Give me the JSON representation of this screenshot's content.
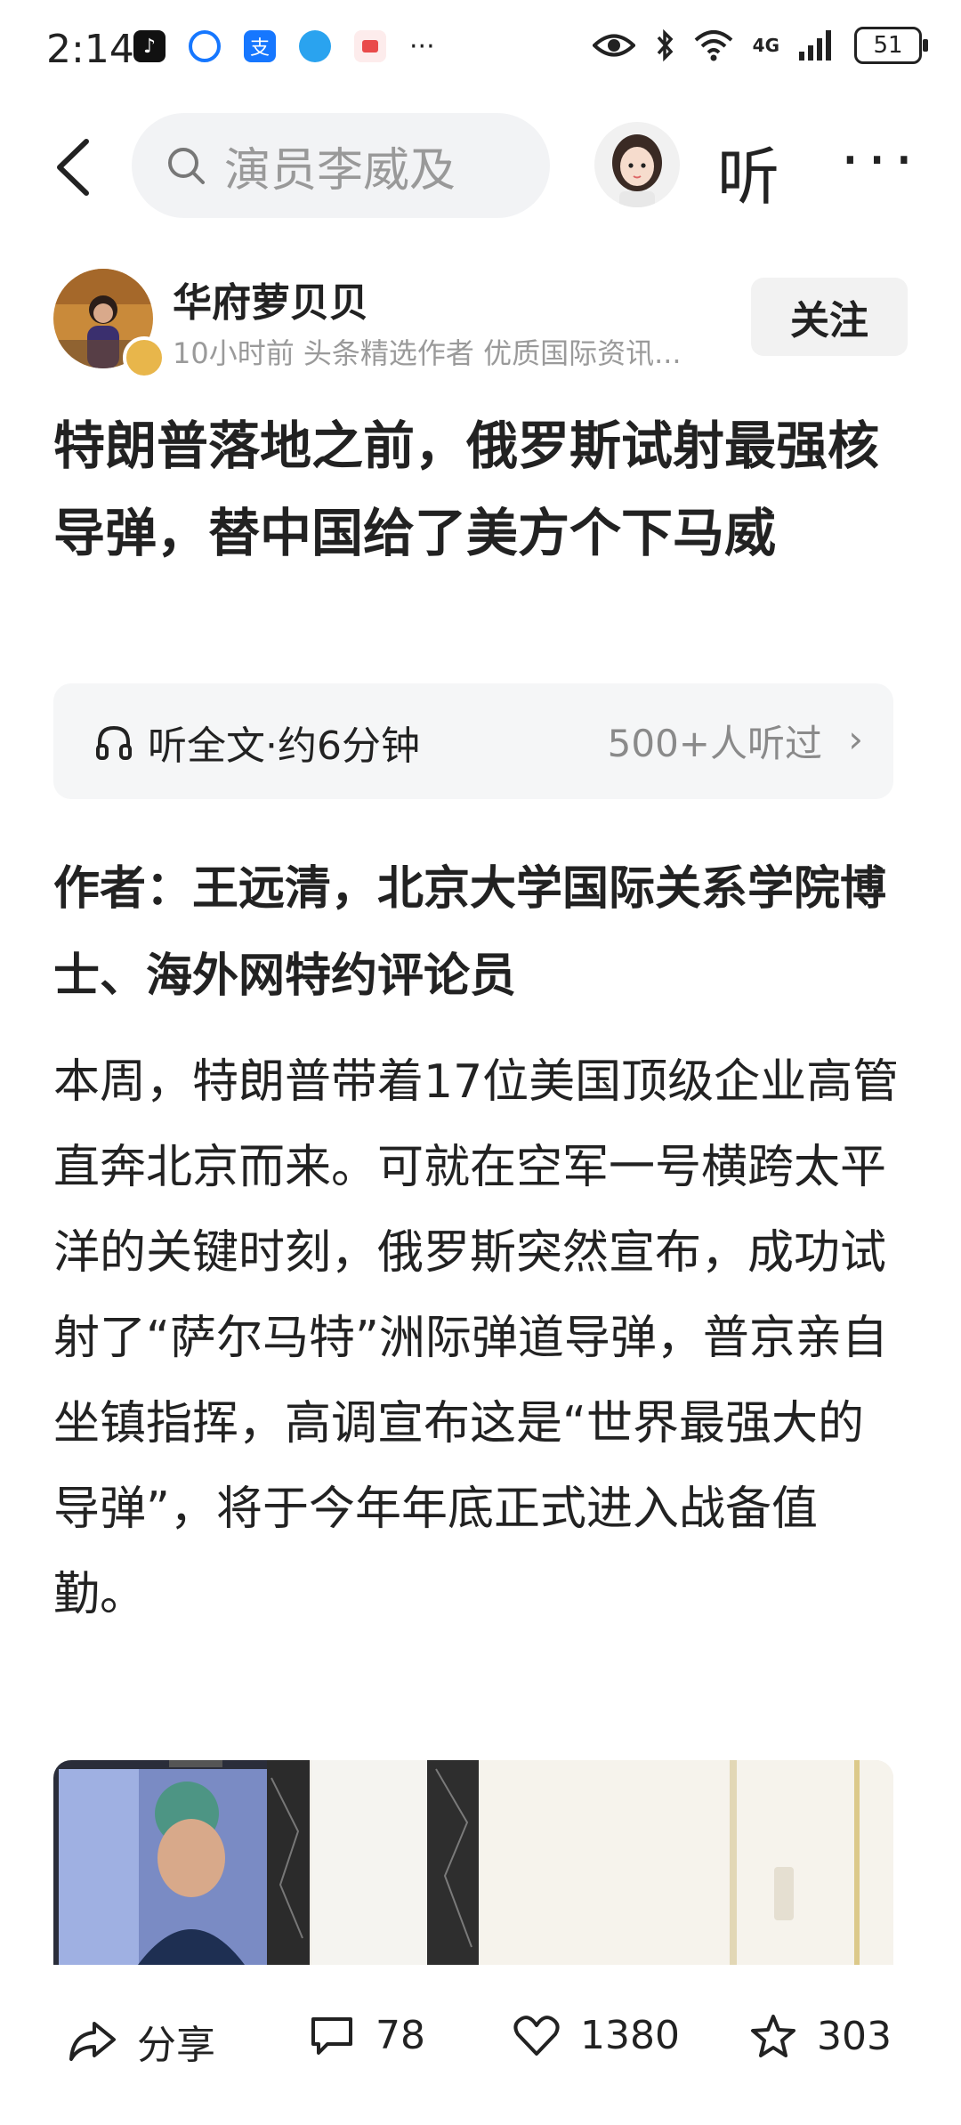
{
  "status_bar": {
    "time": "2:14",
    "network": "4G",
    "battery": "51",
    "more": "···"
  },
  "top_bar": {
    "search_text": "演员李威及",
    "listen_label": "听",
    "more_label": "···"
  },
  "author": {
    "name": "华府萝贝贝",
    "meta": "10小时前  头条精选作者 优质国际资讯...",
    "follow_label": "关注"
  },
  "article": {
    "title": "特朗普落地之前，俄罗斯试射最强核导弹，替中国给了美方个下马威",
    "listen_card": {
      "label": "听全文·约6分钟",
      "count": "500+人听过",
      "chevron": "›"
    },
    "byline": "作者：王远清，北京大学国际关系学院博士、海外网特约评论员",
    "body": "本周，特朗普带着17位美国顶级企业高管直奔北京而来。可就在空军一号横跨太平洋的关键时刻，俄罗斯突然宣布，成功试射了“萨尔马特”洲际弹道导弹，普京亲自坐镇指挥，高调宣布这是“世界最强大的导弹”，将于今年年底正式进入战备值勤。"
  },
  "bottom_bar": {
    "share_label": "分享",
    "comments": "78",
    "likes": "1380",
    "favorites": "303"
  },
  "colors": {
    "accent_badge": "#e8b64b",
    "tiktok": "#111111",
    "blue_app": "#1677ff",
    "text": "#222222",
    "muted": "#9a9a9a"
  }
}
